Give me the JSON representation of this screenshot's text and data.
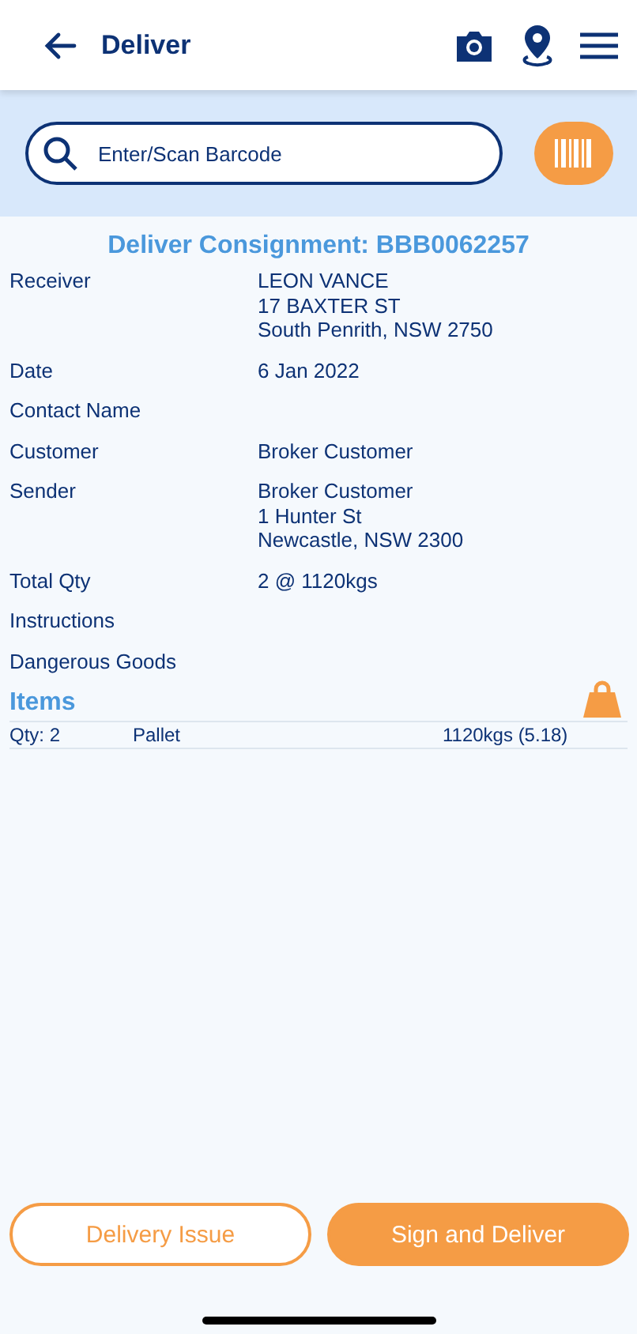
{
  "header": {
    "title": "Deliver"
  },
  "search": {
    "placeholder": "Enter/Scan Barcode"
  },
  "consignment_title": "Deliver Consignment: BBB0062257",
  "details": [
    {
      "label": "Receiver",
      "value": [
        "LEON VANCE",
        "17 BAXTER ST",
        "South Penrith, NSW 2750"
      ]
    },
    {
      "label": "Date",
      "value": [
        "6 Jan 2022"
      ]
    },
    {
      "label": "Contact Name"
    },
    {
      "label": "Customer",
      "value": [
        "Broker Customer"
      ]
    },
    {
      "label": "Sender",
      "value": [
        "Broker Customer",
        "1 Hunter St",
        "Newcastle, NSW 2300"
      ]
    },
    {
      "label": "Total Qty",
      "value": [
        "2 @ 1120kgs"
      ]
    },
    {
      "label": "Instructions"
    },
    {
      "label": "Dangerous Goods"
    }
  ],
  "items": {
    "title": "Items",
    "rows": [
      {
        "qty": "Qty: 2",
        "type": "Pallet",
        "weight": "1120kgs (5.18)"
      }
    ]
  },
  "buttons": [
    {
      "label": "Delivery Issue",
      "kind": "outline"
    },
    {
      "label": "Sign and Deliver",
      "kind": "filled"
    }
  ]
}
